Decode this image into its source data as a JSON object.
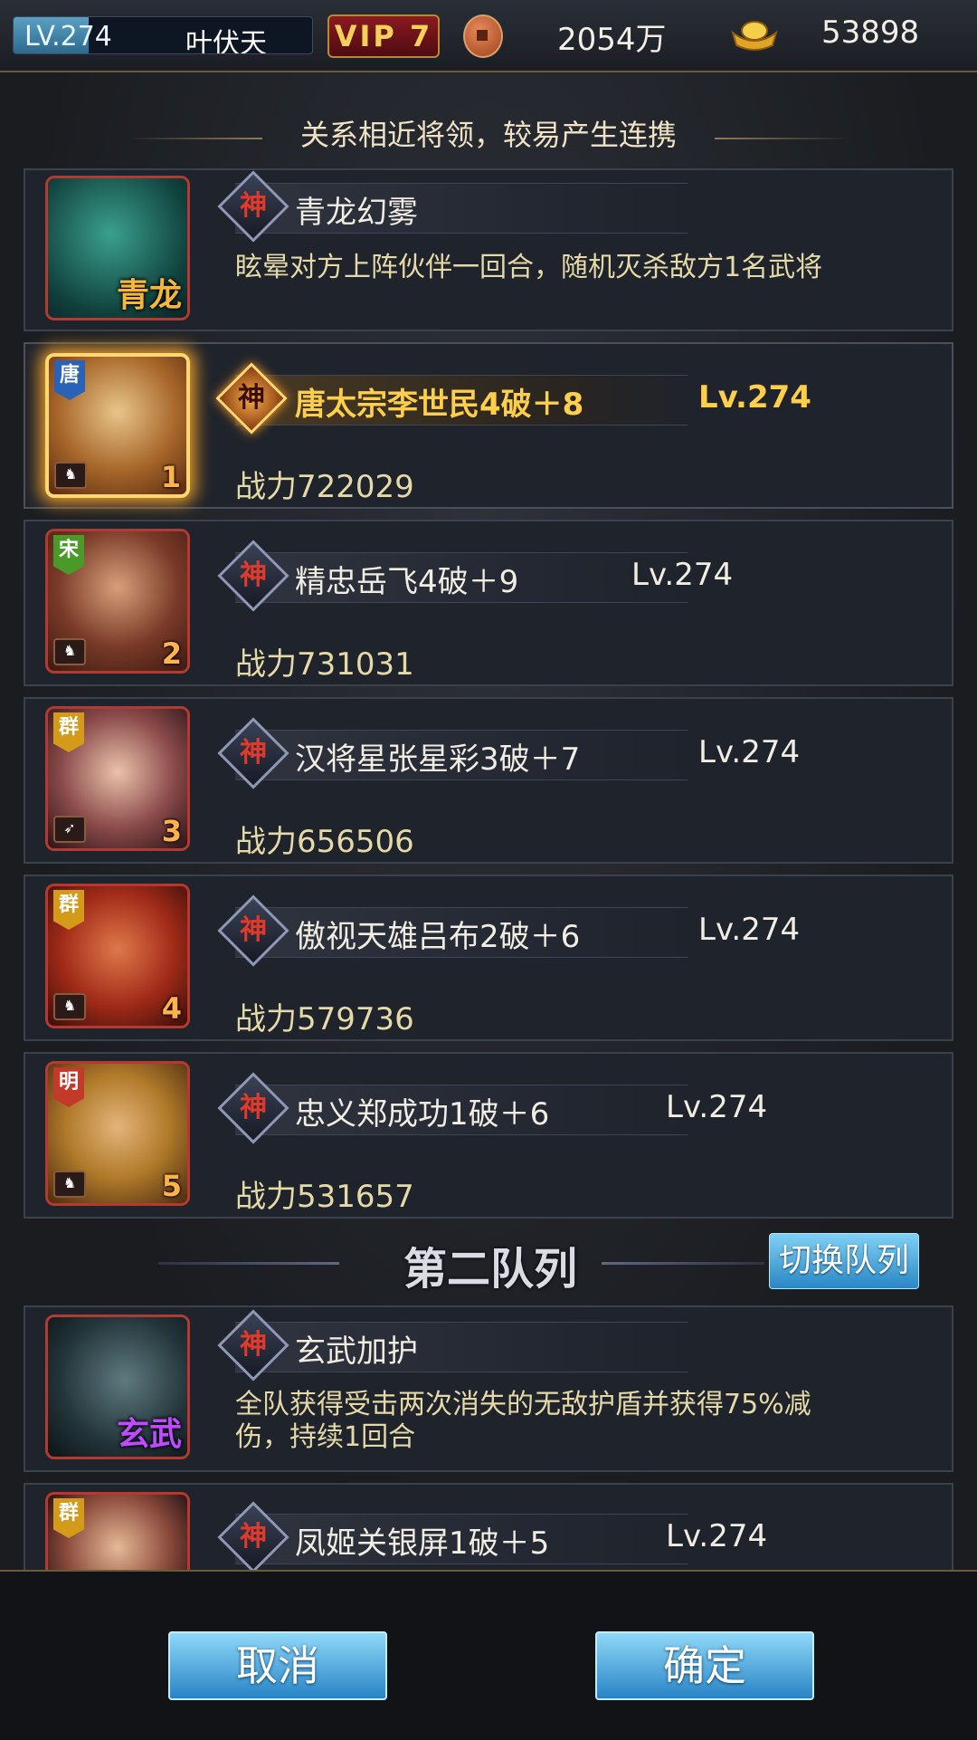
{
  "topbar": {
    "level": "LV.274",
    "level_progress_pct": 25,
    "player_name": "叶伏天",
    "vip": "VIP 7",
    "copper": "2054万",
    "gold": "53898"
  },
  "hint": "关系相近将领，较易产生连携",
  "team1": {
    "beast": {
      "portrait_label": "青龙",
      "skill": "青龙幻雾",
      "desc": "眩晕对方上阵伙伴一回合，随机灭杀敌方1名武将"
    },
    "heroes": [
      {
        "slot": "1",
        "faction": "唐",
        "name": "唐太宗李世民4破＋8",
        "level": "Lv.274",
        "power": "战力722029",
        "highlight": true
      },
      {
        "slot": "2",
        "faction": "宋",
        "name": "精忠岳飞4破＋9",
        "level": "Lv.274",
        "power": "战力731031"
      },
      {
        "slot": "3",
        "faction": "群",
        "name": "汉将星张星彩3破＋7",
        "level": "Lv.274",
        "power": "战力656506"
      },
      {
        "slot": "4",
        "faction": "群",
        "name": "傲视天雄吕布2破＋6",
        "level": "Lv.274",
        "power": "战力579736"
      },
      {
        "slot": "5",
        "faction": "明",
        "name": "忠义郑成功1破＋6",
        "level": "Lv.274",
        "power": "战力531657"
      }
    ]
  },
  "team2": {
    "title": "第二队列",
    "switch_label": "切换队列",
    "beast": {
      "portrait_label": "玄武",
      "skill": "玄武加护",
      "desc": "全队获得受击两次消失的无敌护盾并获得75%减伤，持续1回合"
    },
    "heroes": [
      {
        "faction": "群",
        "name": "凤姬关银屏1破＋5",
        "level": "Lv.274"
      }
    ]
  },
  "skill_badge": "神",
  "buttons": {
    "cancel": "取消",
    "confirm": "确定"
  },
  "colors": {
    "accent_gold": "#ffcf4a",
    "button_blue": "#2884c6",
    "portrait_border": "#b23a30"
  }
}
